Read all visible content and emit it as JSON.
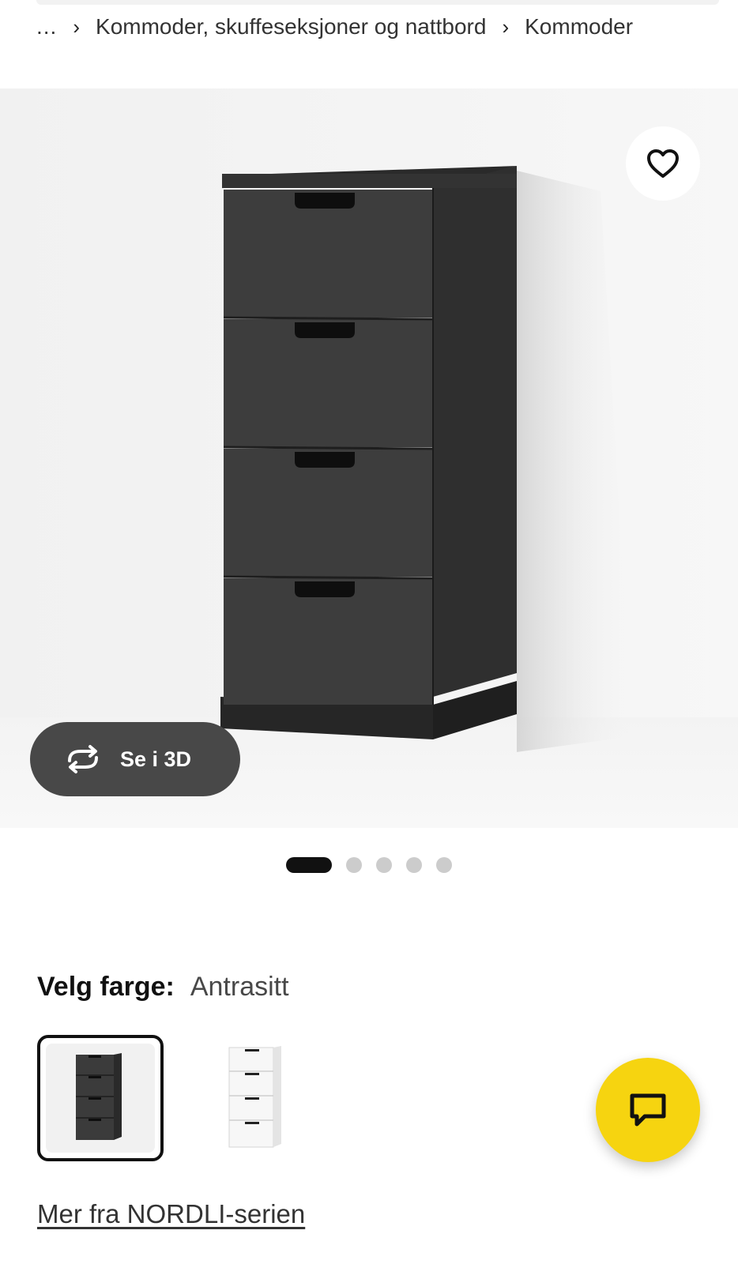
{
  "breadcrumb": {
    "ellipsis": "...",
    "items": [
      "Kommoder, skuffeseksjoner og nattbord",
      "Kommoder"
    ]
  },
  "gallery": {
    "favorite_icon": "heart-icon",
    "view_3d_label": "Se i 3D",
    "view_3d_icon": "rotate-3d-icon",
    "image_count": 5,
    "active_index": 0
  },
  "color_picker": {
    "label": "Velg farge:",
    "selected_value": "Antrasitt",
    "options": [
      {
        "name": "Antrasitt",
        "selected": true
      },
      {
        "name": "Hvit",
        "selected": false
      }
    ]
  },
  "series_link": "Mer fra NORDLI-serien",
  "chat": {
    "icon": "chat-bubble-icon",
    "color": "#f6d410"
  },
  "colors": {
    "accent_yellow": "#f6d410",
    "pill_gray": "#484848",
    "product_dark": "#3b3b3b"
  }
}
